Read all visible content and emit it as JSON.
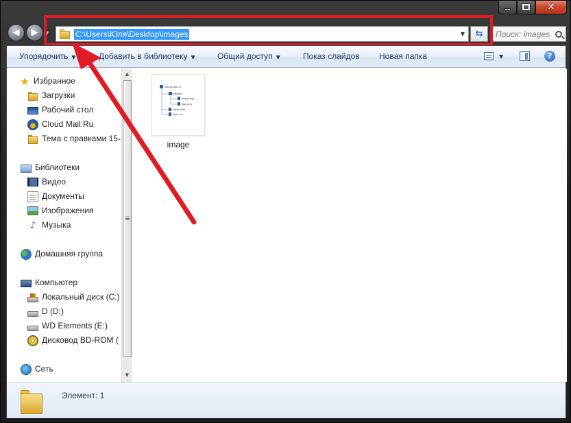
{
  "window": {
    "controls": {
      "minimize_icon": "minimize-icon",
      "maximize_icon": "maximize-icon",
      "close_icon": "close-icon"
    }
  },
  "navigation": {
    "back_glyph": "◀",
    "forward_glyph": "▶",
    "address": "C:\\Users\\Юля\\Desktop\\images",
    "refresh_glyph": "⇆",
    "search_placeholder": "Поиск: images"
  },
  "toolbar": {
    "organize": "Упорядочить",
    "add_to_library": "Добавить в библиотеку",
    "share": "Общий доступ",
    "slideshow": "Показ слайдов",
    "new_folder": "Новая папка",
    "help": "?"
  },
  "sidebar": {
    "favorites": {
      "title": "Избранное",
      "items": [
        {
          "label": "Загрузки",
          "icon": "downloads-folder-icon"
        },
        {
          "label": "Рабочий стол",
          "icon": "desktop-icon"
        },
        {
          "label": "Cloud Mail.Ru",
          "icon": "cloud-mail-icon"
        },
        {
          "label": "Тема с правками 15-",
          "icon": "folder-icon"
        }
      ]
    },
    "libraries": {
      "title": "Библиотеки",
      "items": [
        {
          "label": "Видео",
          "icon": "video-library-icon"
        },
        {
          "label": "Документы",
          "icon": "documents-library-icon"
        },
        {
          "label": "Изображения",
          "icon": "pictures-library-icon"
        },
        {
          "label": "Музыка",
          "icon": "music-library-icon"
        }
      ]
    },
    "homegroup": {
      "title": "Домашняя группа"
    },
    "computer": {
      "title": "Компьютер",
      "items": [
        {
          "label": "Локальный диск (C:)",
          "icon": "local-disk-icon"
        },
        {
          "label": "D (D:)",
          "icon": "drive-icon"
        },
        {
          "label": "WD Elements (E:)",
          "icon": "drive-icon"
        },
        {
          "label": "Дисковод BD-ROM (",
          "icon": "bd-rom-icon"
        }
      ]
    },
    "network": {
      "title": "Сеть"
    }
  },
  "content": {
    "files": [
      {
        "name": "image",
        "thumbnail_tree": [
          "impuls-web.ru",
          "images",
          "image.png",
          "logo.png",
          "index.html",
          "style.css"
        ]
      }
    ]
  },
  "details": {
    "text": "Элемент: 1"
  },
  "colors": {
    "highlight_red": "#e01b24",
    "selection_blue": "#3399ff",
    "toolbar_text": "#1e395b"
  }
}
